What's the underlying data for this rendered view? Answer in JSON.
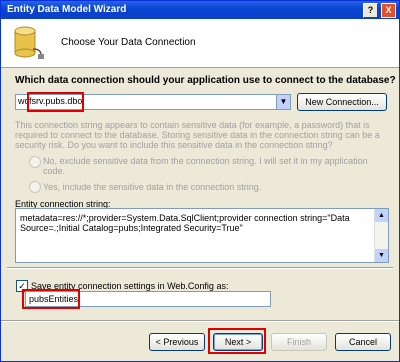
{
  "window": {
    "title": "Entity Data Model Wizard",
    "help_button": "?",
    "close_button": "X"
  },
  "header": {
    "title": "Choose Your Data Connection"
  },
  "connection": {
    "question": "Which data connection should your application use to connect to the database?",
    "selected": "wcfsrv.pubs.dbo",
    "new_button": "New Connection..."
  },
  "sensitive": {
    "description": "This connection string appears to contain sensitive data (for example, a password) that is required to connect to the database. Storing sensitive data in the connection string can be a security risk. Do you want to include this sensitive data in the connection string?",
    "option_no": "No, exclude sensitive data from the connection string. I will set it in my application code.",
    "option_yes": "Yes, include the sensitive data in the connection string."
  },
  "entity_connection": {
    "label": "Entity connection string:",
    "value": "metadata=res://*;provider=System.Data.SqlClient;provider connection string=\"Data Source=.;Initial Catalog=pubs;Integrated Security=True\""
  },
  "save_settings": {
    "checked": true,
    "label": "Save entity connection settings in Web.Config as:",
    "value": "pubsEntities"
  },
  "footer": {
    "previous": "< Previous",
    "next": "Next >",
    "finish": "Finish",
    "cancel": "Cancel"
  },
  "colors": {
    "title_bar": "#0a46d3",
    "highlight": "#e00000"
  }
}
